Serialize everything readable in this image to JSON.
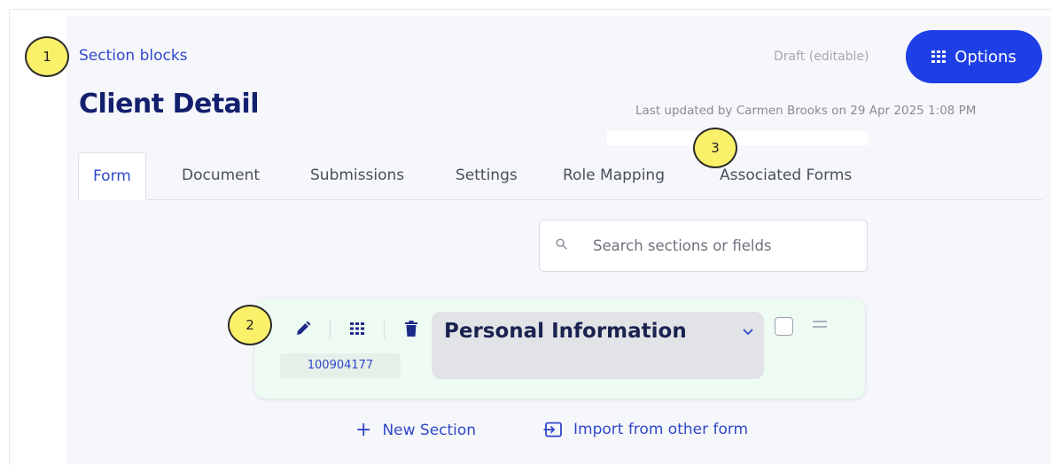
{
  "markers": [
    "1",
    "2",
    "3"
  ],
  "breadcrumb": "Section blocks",
  "page_title": "Client Detail",
  "status": "Draft (editable)",
  "options_label": "Options",
  "last_updated": "Last updated by Carmen Brooks on 29 Apr 2025 1:08 PM",
  "tabs": [
    {
      "label": "Form",
      "active": true
    },
    {
      "label": "Document"
    },
    {
      "label": "Submissions"
    },
    {
      "label": "Settings"
    },
    {
      "label": "Role Mapping"
    },
    {
      "label": "Associated Forms"
    }
  ],
  "search": {
    "placeholder": "Search sections or fields",
    "value": ""
  },
  "section": {
    "id": "100904177",
    "title": "Personal Information"
  },
  "actions": {
    "new_section": "New Section",
    "import": "Import from other form"
  },
  "colors": {
    "accent": "#1f3fe6",
    "link": "#3047c9",
    "title": "#14206e",
    "marker": "#fbf06a"
  },
  "icons": [
    "search-icon",
    "grid-icon",
    "pencil-icon",
    "dots-grid-icon",
    "trash-icon",
    "chevron-down-icon",
    "drag-handle-icon",
    "plus-icon",
    "import-icon"
  ]
}
